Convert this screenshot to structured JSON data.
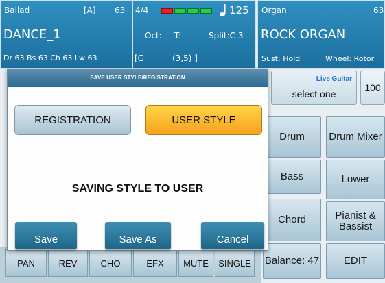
{
  "left_panel": {
    "style_category": "Ballad",
    "variation": "[A]",
    "style_num": "63",
    "style_name": "DANCE_1",
    "channels": "Dr 63  Bs 63  Ch 63  Lw 63"
  },
  "mid_panel": {
    "time_signature": "4/4",
    "tempo": "125",
    "octave": "Oct:--",
    "transpose": "T:--",
    "split": "Split:C 3",
    "chord_bracket": "[G",
    "chord_value": "(3,5) ]"
  },
  "right_panel": {
    "voice_category": "Organ",
    "voice_num": "63",
    "voice_name": "ROCK ORGAN",
    "sustain": "Sust: Hold",
    "wheel": "Wheel: Rotor"
  },
  "live_guitar": {
    "tag": "Live Guitar",
    "select": "select one",
    "value": "100"
  },
  "right_buttons": {
    "drum": "Drum",
    "drum_mixer": "Drum Mixer",
    "bass": "Bass",
    "lower": "Lower",
    "chord": "Chord",
    "pianist_bassist": "Pianist & Bassist",
    "balance": "Balance: 47",
    "edit": "EDIT"
  },
  "mixer_strip": [
    "PAN",
    "REV",
    "CHO",
    "EFX",
    "MUTE",
    "SINGLE"
  ],
  "dialog": {
    "title": "SAVE USER STYLE/REGISTRATION",
    "tab_registration": "REGISTRATION",
    "tab_user_style": "USER STYLE",
    "message": "SAVING STYLE TO USER",
    "save": "Save",
    "save_as": "Save As",
    "cancel": "Cancel"
  },
  "colors": {
    "panel_blue": "#2a86b8",
    "active_tab": "#f7b12a",
    "meter_green": "#1fd14a",
    "meter_red": "#e32424"
  }
}
